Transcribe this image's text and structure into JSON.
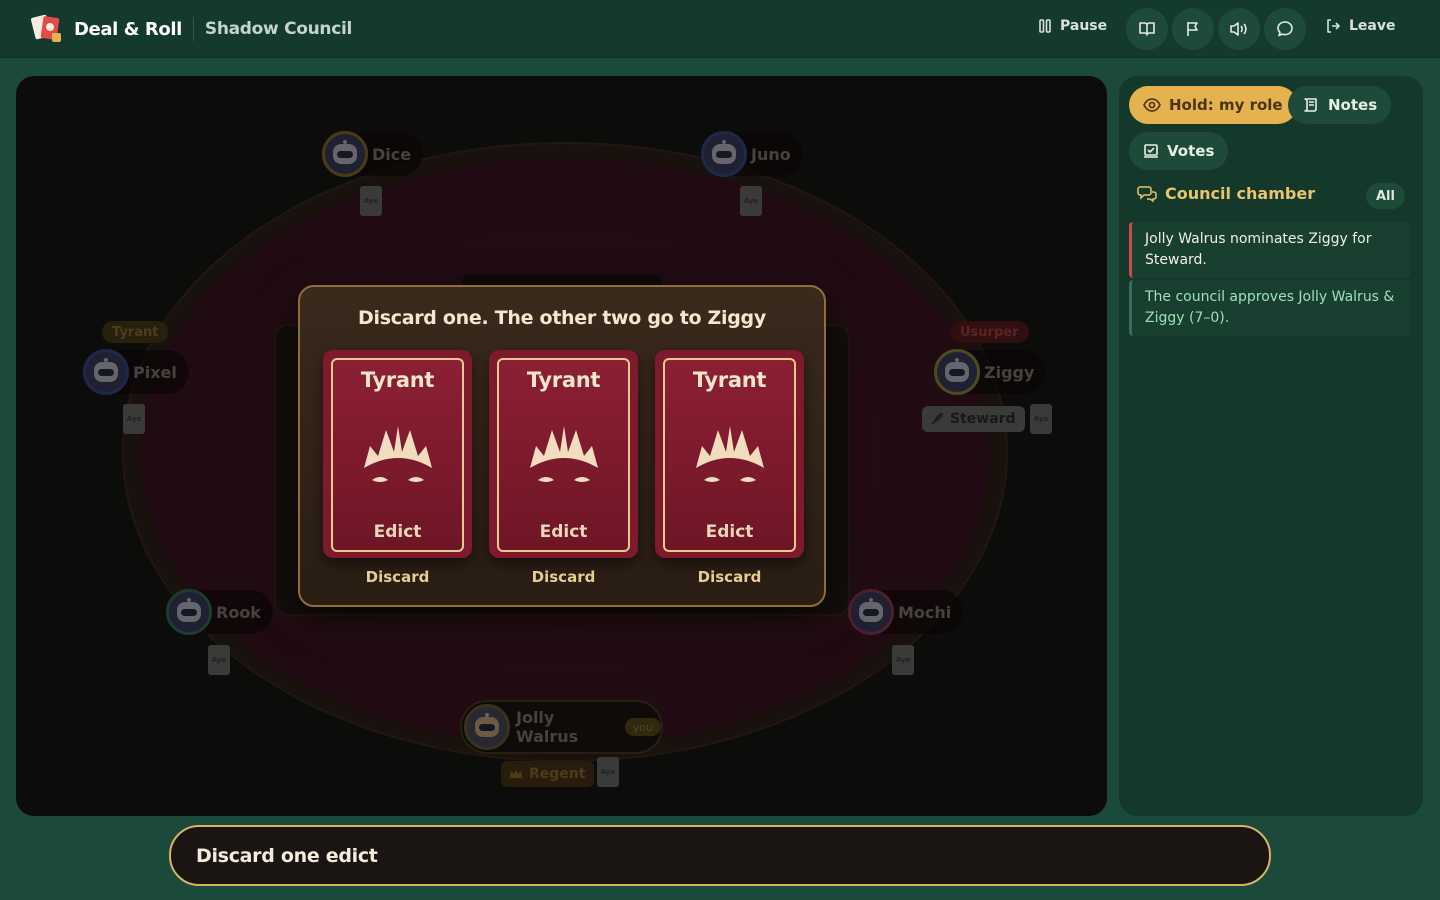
{
  "header": {
    "brand": "Deal & Roll",
    "game": "Shadow Council",
    "pause_label": "Pause",
    "leave_label": "Leave",
    "icons": [
      "rulebook-icon",
      "flag-icon",
      "sound-icon",
      "chat-icon"
    ]
  },
  "board": {
    "players": [
      {
        "name": "Dice",
        "vote": "Aye"
      },
      {
        "name": "Juno",
        "vote": "Aye"
      },
      {
        "name": "Pixel",
        "role": "Tyrant",
        "vote": "Aye"
      },
      {
        "name": "Ziggy",
        "role": "Usurper",
        "office": "Steward",
        "vote": "Aye"
      },
      {
        "name": "Rook",
        "vote": "Aye"
      },
      {
        "name": "Mochi",
        "vote": "Aye"
      }
    ],
    "you": {
      "name": "Jolly Walrus",
      "badge": "you",
      "office": "Regent",
      "vote": "Aye"
    }
  },
  "modal": {
    "title": "Discard one. The other two go to Ziggy",
    "cards": [
      {
        "title": "Tyrant",
        "subtitle": "Edict",
        "action": "Discard"
      },
      {
        "title": "Tyrant",
        "subtitle": "Edict",
        "action": "Discard"
      },
      {
        "title": "Tyrant",
        "subtitle": "Edict",
        "action": "Discard"
      }
    ],
    "card_color": "#7e1a2c",
    "accent": "#e7c98d"
  },
  "side": {
    "hold_label": "Hold: my role",
    "notes_label": "Notes",
    "votes_label": "Votes",
    "chamber_title": "Council chamber",
    "filter_label": "All",
    "log": [
      {
        "text": "Jolly Walrus nominates Ziggy for Steward.",
        "kind": "action"
      },
      {
        "text": "The council approves Jolly Walrus & Ziggy (7–0).",
        "kind": "result"
      }
    ]
  },
  "action_bar": {
    "prompt": "Discard one edict"
  }
}
